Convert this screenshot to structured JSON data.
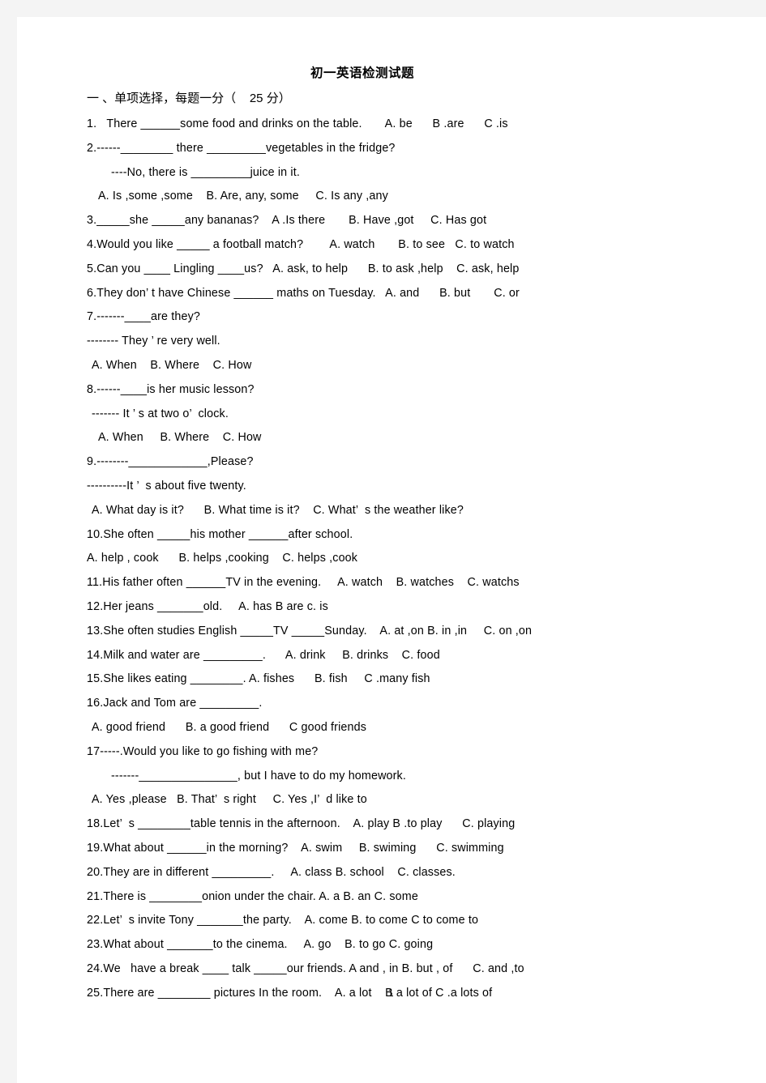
{
  "document": {
    "title": "初一英语检测试题",
    "section_heading": "一 、单项选择，每题一分（    25 分）",
    "page_number": "1",
    "lines": [
      {
        "id": "q1",
        "indent": 0,
        "text": "1.   There ______some food and drinks on the table.       A. be      B .are      C .is"
      },
      {
        "id": "q2",
        "indent": 0,
        "text": "2.------________ there _________vegetables in the fridge?"
      },
      {
        "id": "q2b",
        "indent": 3,
        "text": "----No, there is _________juice in it."
      },
      {
        "id": "q2opts",
        "indent": 2,
        "text": "A. Is ,some ,some    B. Are, any, some     C. Is any ,any"
      },
      {
        "id": "q3",
        "indent": 0,
        "text": "3._____she _____any bananas?    A .Is there       B. Have ,got     C. Has got"
      },
      {
        "id": "q4",
        "indent": 0,
        "text": "4.Would you like _____ a football match?        A. watch       B. to see   C. to watch"
      },
      {
        "id": "q5",
        "indent": 0,
        "text": "5.Can you ____ Lingling ____us?   A. ask, to help      B. to ask ,help    C. ask, help"
      },
      {
        "id": "q6",
        "indent": 0,
        "text": "6.They don’ t have Chinese ______ maths on Tuesday.   A. and      B. but       C. or"
      },
      {
        "id": "q7",
        "indent": 0,
        "text": "7.-------____are they?"
      },
      {
        "id": "q7b",
        "indent": 0,
        "text": "-------- They ’ re very well."
      },
      {
        "id": "q7opts",
        "indent": 1,
        "text": "A. When    B. Where    C. How"
      },
      {
        "id": "q8",
        "indent": 0,
        "text": "8.------____is her music lesson?"
      },
      {
        "id": "q8b",
        "indent": 1,
        "text": "------- It ’ s at two o’  clock."
      },
      {
        "id": "q8opts",
        "indent": 2,
        "text": "A. When     B. Where    C. How"
      },
      {
        "id": "q9",
        "indent": 0,
        "text": "9.--------____________,Please?"
      },
      {
        "id": "q9b",
        "indent": 0,
        "text": "----------It ’  s about five twenty."
      },
      {
        "id": "q9opts",
        "indent": 1,
        "text": "A. What day is it?      B. What time is it?    C. What’  s the weather like?"
      },
      {
        "id": "q10",
        "indent": 0,
        "text": "10.She often _____his mother ______after school."
      },
      {
        "id": "q10opts",
        "indent": 0,
        "text": "A. help , cook      B. helps ,cooking    C. helps ,cook"
      },
      {
        "id": "q11",
        "indent": 0,
        "text": "11.His father often ______TV in the evening.     A. watch    B. watches    C. watchs"
      },
      {
        "id": "q12",
        "indent": 0,
        "text": "12.Her jeans _______old.     A. has B are c. is"
      },
      {
        "id": "q13",
        "indent": 0,
        "text": "13.She often studies English _____TV _____Sunday.    A. at ,on B. in ,in     C. on ,on"
      },
      {
        "id": "q14",
        "indent": 0,
        "text": "14.Milk and water are _________.      A. drink     B. drinks    C. food"
      },
      {
        "id": "q15",
        "indent": 0,
        "text": "15.She likes eating ________. A. fishes      B. fish     C .many fish"
      },
      {
        "id": "q16",
        "indent": 0,
        "text": "16.Jack and Tom are _________."
      },
      {
        "id": "q16opts",
        "indent": 1,
        "text": "A. good friend      B. a good friend      C good friends"
      },
      {
        "id": "q17",
        "indent": 0,
        "text": "17-----.Would you like to go fishing with me?"
      },
      {
        "id": "q17b",
        "indent": 3,
        "text": "-------_______________, but I have to do my homework."
      },
      {
        "id": "q17opts",
        "indent": 1,
        "text": "A. Yes ,please   B. That’  s right     C. Yes ,I’  d like to"
      },
      {
        "id": "q18",
        "indent": 0,
        "text": "18.Let’  s ________table tennis in the afternoon.    A. play B .to play      C. playing"
      },
      {
        "id": "q19",
        "indent": 0,
        "text": "19.What about ______in the morning?    A. swim     B. swiming      C. swimming"
      },
      {
        "id": "q20",
        "indent": 0,
        "text": "20.They are in different _________.     A. class B. school    C. classes."
      },
      {
        "id": "q21",
        "indent": 0,
        "text": "21.There is ________onion under the chair. A. a B. an C. some"
      },
      {
        "id": "q22",
        "indent": 0,
        "text": "22.Let’  s invite Tony _______the party.    A. come B. to come C to come to"
      },
      {
        "id": "q23",
        "indent": 0,
        "text": "23.What about _______to the cinema.     A. go    B. to go C. going"
      },
      {
        "id": "q24",
        "indent": 0,
        "text": "24.We   have a break ____ talk _____our friends. A and , in B. but , of      C. and ,to"
      },
      {
        "id": "q25",
        "indent": 0,
        "text": "25.There are ________ pictures In the room.    A. a lot    B a lot of C .a lots of"
      }
    ]
  }
}
